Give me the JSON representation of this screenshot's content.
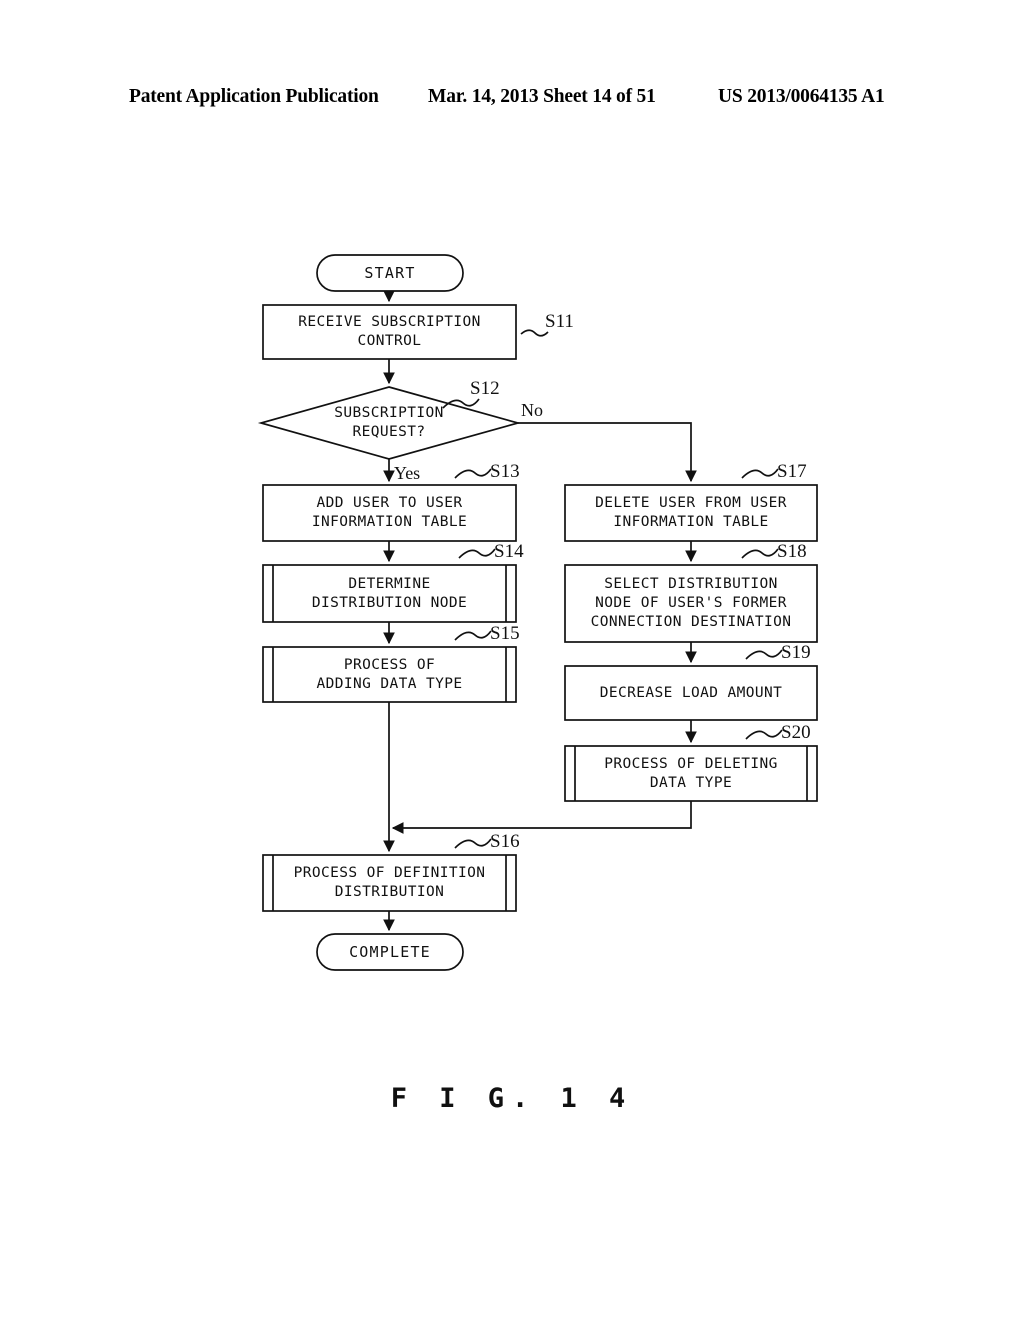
{
  "header": {
    "publication": "Patent Application Publication",
    "date_sheet": "Mar. 14, 2013  Sheet 14 of 51",
    "pub_number": "US 2013/0064135 A1"
  },
  "figure": {
    "caption": "F I G.  1 4"
  },
  "flowchart": {
    "start_label": "START",
    "complete_label": "COMPLETE",
    "branch_yes": "Yes",
    "branch_no": "No",
    "nodes": [
      {
        "id": "s11",
        "tag": "S11",
        "shape": "process",
        "lines": [
          "RECEIVE SUBSCRIPTION",
          "CONTROL"
        ]
      },
      {
        "id": "s12",
        "tag": "S12",
        "shape": "decision",
        "lines": [
          "SUBSCRIPTION",
          "REQUEST?"
        ]
      },
      {
        "id": "s13",
        "tag": "S13",
        "shape": "process",
        "lines": [
          "ADD USER TO USER",
          "INFORMATION TABLE"
        ]
      },
      {
        "id": "s14",
        "tag": "S14",
        "shape": "predefined-process",
        "lines": [
          "DETERMINE",
          "DISTRIBUTION NODE"
        ]
      },
      {
        "id": "s15",
        "tag": "S15",
        "shape": "predefined-process",
        "lines": [
          "PROCESS OF",
          "ADDING DATA TYPE"
        ]
      },
      {
        "id": "s16",
        "tag": "S16",
        "shape": "predefined-process",
        "lines": [
          "PROCESS OF DEFINITION",
          "DISTRIBUTION"
        ]
      },
      {
        "id": "s17",
        "tag": "S17",
        "shape": "process",
        "lines": [
          "DELETE USER FROM USER",
          "INFORMATION TABLE"
        ]
      },
      {
        "id": "s18",
        "tag": "S18",
        "shape": "process",
        "lines": [
          "SELECT DISTRIBUTION",
          "NODE OF USER'S FORMER",
          "CONNECTION DESTINATION"
        ]
      },
      {
        "id": "s19",
        "tag": "S19",
        "shape": "process",
        "lines": [
          "DECREASE LOAD AMOUNT"
        ]
      },
      {
        "id": "s20",
        "tag": "S20",
        "shape": "predefined-process",
        "lines": [
          "PROCESS OF DELETING",
          "DATA TYPE"
        ]
      }
    ]
  },
  "colors": {
    "ink": "#111111",
    "page": "#ffffff"
  }
}
